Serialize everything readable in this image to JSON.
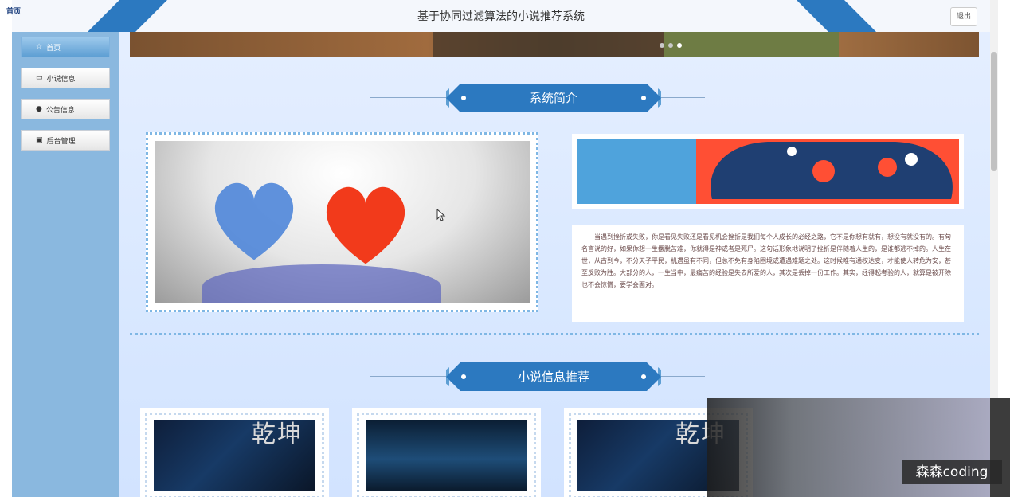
{
  "header": {
    "corner_label": "首页",
    "title": "基于协同过滤算法的小说推荐系统",
    "logout_label": "退出"
  },
  "sidebar": {
    "items": [
      {
        "label": "首页",
        "icon": "home-icon",
        "active": true
      },
      {
        "label": "小说信息",
        "icon": "book-icon",
        "active": false
      },
      {
        "label": "公告信息",
        "icon": "info-icon",
        "active": false
      },
      {
        "label": "后台管理",
        "icon": "admin-icon",
        "active": false
      }
    ]
  },
  "carousel": {
    "slides": 3,
    "active_index": 2
  },
  "intro_section": {
    "title": "系统简介",
    "text": "当遇到挫折或失败，你是看见失败还是看见机会挫折是我们每个人成长的必经之路，它不是你想有就有，想没有就没有的。有句名言说的好，如果你想一生摆脱苦难，你就得是神或者是死尸。这句话形象地说明了挫折是伴随着人生的，是谁都逃不掉的。人生在世，从古到今，不分天子平民，机遇虽有不同，但总不免有身陷困境或遭遇难题之处。这时候唯有通权达变，才能使人转危为安，甚至反败为胜。大部分的人，一生当中，最痛苦的经验是失去所爱的人，其次是丢掉一份工作。其实，经得起考验的人，就算是被开除也不会惊慌，要学会面对。"
  },
  "recommend_section": {
    "title": "小说信息推荐",
    "cards": [
      {
        "cover": "dragon-cover",
        "cover_text": "乾坤"
      },
      {
        "cover": "forest-cover",
        "cover_text": ""
      },
      {
        "cover": "dragon-cover",
        "cover_text": "乾坤"
      }
    ]
  },
  "watermark": "森森coding",
  "colors": {
    "accent": "#2c79c0",
    "sidebar_bg": "#8ab8df",
    "page_bg": "#d9e8ff",
    "active_menu": "#5e9fd4"
  }
}
